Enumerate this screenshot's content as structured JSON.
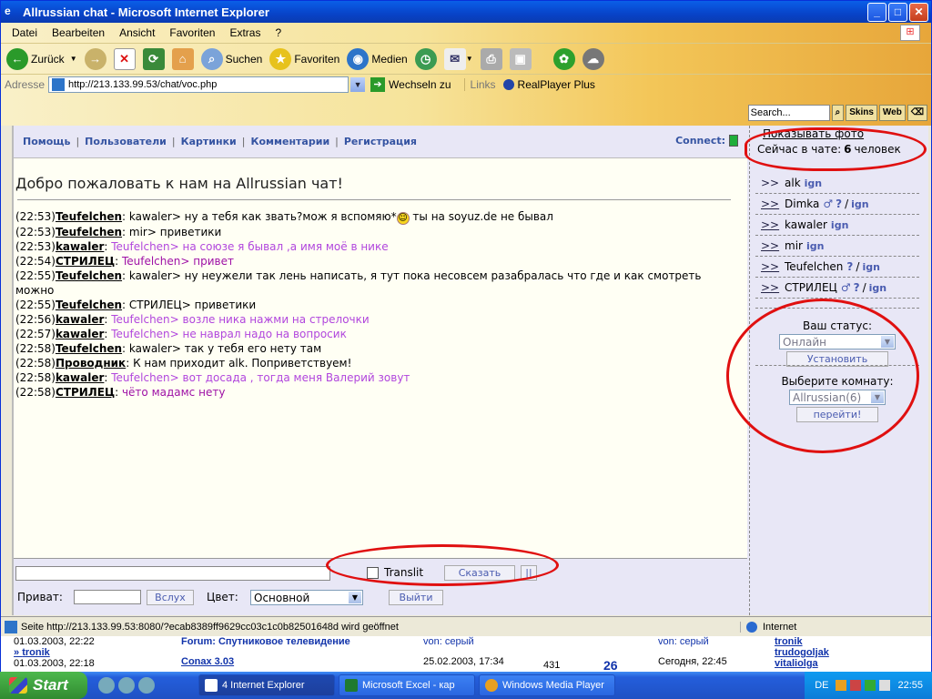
{
  "window": {
    "title": "Allrussian chat - Microsoft Internet Explorer"
  },
  "menu": [
    "Datei",
    "Bearbeiten",
    "Ansicht",
    "Favoriten",
    "Extras",
    "?"
  ],
  "toolbar": {
    "back": "Zurück",
    "search": "Suchen",
    "favorites": "Favoriten",
    "media": "Medien"
  },
  "address": {
    "label": "Adresse",
    "url": "http://213.133.99.53/chat/voc.php",
    "go": "Wechseln zu",
    "links": "Links",
    "realplayer": "RealPlayer Plus"
  },
  "searchbar": {
    "placeholder": "Search...",
    "skins": "Skins",
    "web": "Web"
  },
  "nav": {
    "items": [
      "Помощь",
      "Пользователи",
      "Картинки",
      "Комментарии",
      "Регистрация"
    ],
    "connect": "Connect:"
  },
  "chat": {
    "welcome": "Добро пожаловать к нам на Allrussian чат!",
    "messages": [
      {
        "time": "(22:53)",
        "nick": "Teufelchen",
        "text": "kawaler> ну а тебя как звать?мож я вспомяю*",
        "tail": " ты на soyuz.de не бывал",
        "style": "black"
      },
      {
        "time": "(22:53)",
        "nick": "Teufelchen",
        "text": "mir> приветики",
        "tail": "",
        "style": "black"
      },
      {
        "time": "(22:53)",
        "nick": "kawaler",
        "text": "Teufelchen> на союзе я бывал ,а имя моё в нике",
        "tail": "",
        "style": "purple"
      },
      {
        "time": "(22:54)",
        "nick": "СТРИЛЕЦ",
        "text": "Teufelchen> привет",
        "tail": "",
        "style": "pink"
      },
      {
        "time": "(22:55)",
        "nick": "Teufelchen",
        "text": "kawaler> ну неужели так лень написать, я тут пока несовсем разабралась что где и как смотреть можно",
        "tail": "",
        "style": "black"
      },
      {
        "time": "(22:55)",
        "nick": "Teufelchen",
        "text": "СТРИЛЕЦ> приветики",
        "tail": "",
        "style": "black"
      },
      {
        "time": "(22:56)",
        "nick": "kawaler",
        "text": "Teufelchen> возле ника нажми на стрелочки",
        "tail": "",
        "style": "purple"
      },
      {
        "time": "(22:57)",
        "nick": "kawaler",
        "text": "Teufelchen> не наврал надо на вопросик",
        "tail": "",
        "style": "purple"
      },
      {
        "time": "(22:58)",
        "nick": "Teufelchen",
        "text": "kawaler> так у тебя его нету там",
        "tail": "",
        "style": "black"
      },
      {
        "time": "(22:58)",
        "nick": "Проводник",
        "text": "К нам приходит alk. Поприветствуем!",
        "tail": "",
        "style": "black"
      },
      {
        "time": "(22:58)",
        "nick": "kawaler",
        "text": "Teufelchen> вот досада , тогда меня Валерий зовут",
        "tail": "",
        "style": "purple"
      },
      {
        "time": "(22:58)",
        "nick": "СТРИЛЕЦ",
        "text": "чёто мадамс нету",
        "tail": "",
        "style": "pink"
      }
    ]
  },
  "input": {
    "translit": "Translit",
    "say": "Сказать",
    "pause": "||",
    "private_label": "Приват:",
    "aloud": "Вслух",
    "color_label": "Цвет:",
    "color_value": "Основной",
    "exit": "Выйти"
  },
  "sidebar": {
    "show_photo": "Показывать фото",
    "online_prefix": "Сейчас в чате:",
    "online_count": "6",
    "online_suffix": "человек",
    "users": [
      {
        "name": "alk",
        "gender": "",
        "q": ""
      },
      {
        "name": "Dimka",
        "gender": "♂",
        "q": "?"
      },
      {
        "name": "kawaler",
        "gender": "",
        "q": ""
      },
      {
        "name": "mir",
        "gender": "",
        "q": ""
      },
      {
        "name": "Teufelchen",
        "gender": "",
        "q": "?"
      },
      {
        "name": "СТРИЛЕЦ",
        "gender": "♂",
        "q": "?"
      }
    ],
    "arrow": ">>",
    "ign": "ign",
    "status_label": "Ваш статус:",
    "status_value": "Онлайн",
    "set_button": "Установить",
    "room_label": "Выберите комнату:",
    "room_value": "Allrussian(6)",
    "go_button": "перейти!"
  },
  "status": {
    "text": "Seite http://213.133.99.53:8080/?ecab8389ff9629cc03c1c0b82501648d wird geöffnet",
    "zone": "Internet"
  },
  "below": {
    "date1": "01.03.2003, 22:22",
    "user1": "tronik",
    "date2": "01.03.2003, 22:18",
    "forum": "Forum: Спутниковое телевидение",
    "from1": "von: серый",
    "conax": "Conax 3.03",
    "date3": "25.02.2003, 17:34",
    "n1": "431",
    "n2": "26",
    "today": "Сегодня, 22:45",
    "from2": "von: серый",
    "r1": "tronik",
    "r2": "trudogoljak",
    "r3": "vitaliolga"
  },
  "taskbar": {
    "start": "Start",
    "tasks": [
      "4 Internet Explorer",
      "Microsoft Excel - кар",
      "Windows Media Player"
    ],
    "lang": "DE",
    "clock": "22:55"
  }
}
